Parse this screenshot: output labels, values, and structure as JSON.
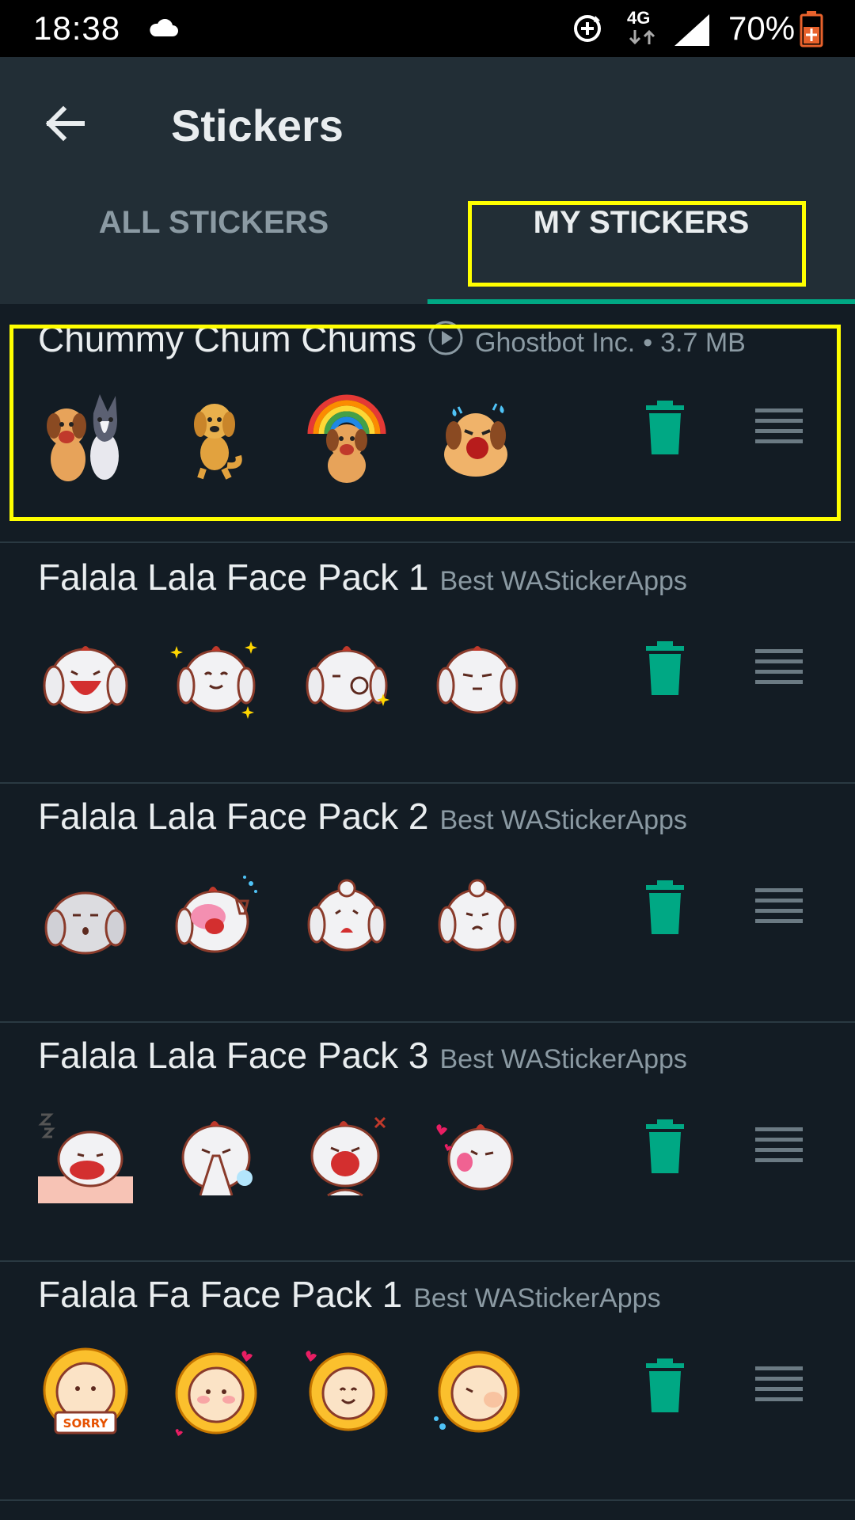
{
  "status_bar": {
    "time": "18:38",
    "network": "4G",
    "battery": "70%",
    "icons": [
      "cloud-icon",
      "sync-icon",
      "signal-icon",
      "battery-icon"
    ]
  },
  "app_bar": {
    "title": "Stickers",
    "back_icon": "arrow-left-icon"
  },
  "tabs": [
    {
      "label": "ALL STICKERS",
      "selected": false
    },
    {
      "label": "MY STICKERS",
      "selected": true
    }
  ],
  "colors": {
    "accent": "#00a884",
    "highlight": "#ffff00",
    "background": "#131c24",
    "app_bar": "#222e36"
  },
  "packs": [
    {
      "name": "Chummy Chum Chums",
      "author": "Ghostbot Inc.",
      "separator": "•",
      "size": "3.7 MB",
      "animated": true,
      "sticker_theme": "dog"
    },
    {
      "name": "Falala Lala Face Pack 1",
      "author": "Best WAStickerApps",
      "sticker_theme": "white-puppy"
    },
    {
      "name": "Falala Lala Face Pack 2",
      "author": "Best WAStickerApps",
      "sticker_theme": "white-puppy"
    },
    {
      "name": "Falala Lala Face Pack 3",
      "author": "Best WAStickerApps",
      "sticker_theme": "white-puppy"
    },
    {
      "name": "Falala Fa Face Pack 1",
      "author": "Best WAStickerApps",
      "sticker_theme": "sunflower",
      "sticker_text": "SORRY"
    }
  ]
}
